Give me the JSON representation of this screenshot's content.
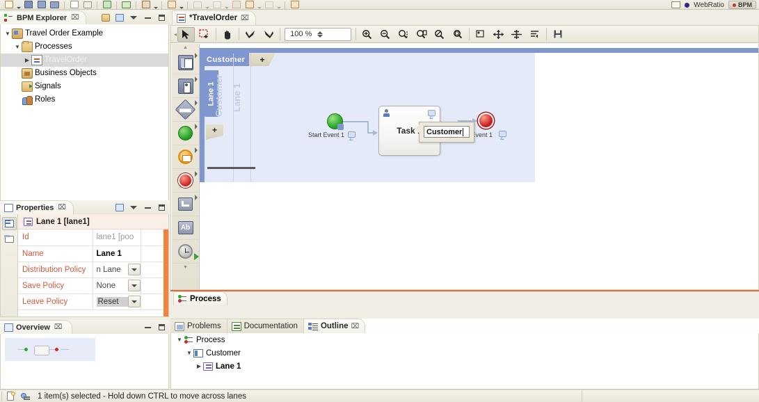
{
  "global_toolbar": {
    "icons": [
      "new-wizard-icon",
      "open-perspective-icon",
      "save-icon",
      "save-all-icon",
      "new-page-icon",
      "new-unit-icon",
      "deploy-icon",
      "link-icon",
      "run-icon",
      "debug-icon",
      "search-icon",
      "history-back-icon",
      "history-forward-icon",
      "undo-icon",
      "redo-icon",
      "quick-access-icon"
    ]
  },
  "perspective_bar": {
    "open_perspective_icon": "open-perspective-icon",
    "product_name": "WebRatio",
    "active_perspective": "BPM"
  },
  "explorer": {
    "tab_label": "BPM Explorer",
    "tab_icon": "bpm-explorer-icon",
    "close_label": "⌧",
    "toolbar": [
      {
        "name": "collapse-all-icon",
        "label": ""
      },
      {
        "name": "link-with-editor-icon",
        "label": ""
      },
      {
        "name": "view-menu-icon",
        "label": ""
      },
      {
        "name": "minimize-icon",
        "label": ""
      },
      {
        "name": "maximize-icon",
        "label": ""
      }
    ],
    "tree": [
      {
        "label": "Travel Order Example",
        "indent": 0,
        "twisty": "open",
        "icon": "project-icon",
        "selected": false
      },
      {
        "label": "Processes",
        "indent": 1,
        "twisty": "open",
        "icon": "folder-icon",
        "selected": false
      },
      {
        "label": "TravelOrder",
        "indent": 2,
        "twisty": "closed",
        "icon": "process-file-icon",
        "selected": true
      },
      {
        "label": "Business Objects",
        "indent": 1,
        "twisty": "none",
        "icon": "business-objects-icon",
        "selected": false
      },
      {
        "label": "Signals",
        "indent": 1,
        "twisty": "none",
        "icon": "signals-icon",
        "selected": false
      },
      {
        "label": "Roles",
        "indent": 1,
        "twisty": "none",
        "icon": "roles-icon",
        "selected": false
      }
    ]
  },
  "properties": {
    "tab_label": "Properties",
    "tab_icon": "properties-icon",
    "close_label": "⌧",
    "toolbar": [
      {
        "name": "pin-properties-icon"
      },
      {
        "name": "view-menu-icon"
      },
      {
        "name": "minimize-icon"
      },
      {
        "name": "maximize-icon"
      }
    ],
    "side_tabs": [
      {
        "name": "general-tab-icon",
        "active": true
      },
      {
        "name": "advanced-tab-icon",
        "active": false
      }
    ],
    "header_title": "Lane 1 [lane1]",
    "header_icon": "lane-icon",
    "rows": [
      {
        "key": "Id",
        "value": "lane1  [poo",
        "type": "text",
        "muted": true,
        "bold": false
      },
      {
        "key": "Name",
        "value": "Lane 1",
        "type": "text",
        "muted": false,
        "bold": true
      },
      {
        "key": "Distribution Policy",
        "value": "n Lane",
        "type": "combo",
        "muted": false,
        "bold": false
      },
      {
        "key": "Save Policy",
        "value": "None",
        "type": "combo",
        "muted": false,
        "bold": false
      },
      {
        "key": "Leave Policy",
        "value": "Reset",
        "type": "combo",
        "muted": false,
        "bold": false,
        "highlight": true
      }
    ],
    "scrollbar_color": "#f2833e"
  },
  "overview": {
    "tab_label": "Overview",
    "tab_icon": "overview-icon",
    "close_label": "⌧",
    "toolbar": [
      {
        "name": "minimize-icon"
      },
      {
        "name": "maximize-icon"
      }
    ]
  },
  "editor": {
    "tab_label": "*TravelOrder",
    "tab_icon": "process-file-icon",
    "close_label": "⌧",
    "dirty": true,
    "toolbar": {
      "tools": [
        {
          "name": "select-tool-button",
          "pressed": true
        },
        {
          "name": "marquee-tool-button",
          "pressed": false
        },
        {
          "name": "pan-tool-button",
          "pressed": false
        },
        {
          "name": "previous-tool-button",
          "pressed": false
        },
        {
          "name": "next-tool-button",
          "pressed": false
        }
      ],
      "zoom_value": "100 %",
      "zoom_buttons": [
        {
          "name": "zoom-in-button"
        },
        {
          "name": "zoom-out-button"
        },
        {
          "name": "zoom-fit-width-button"
        },
        {
          "name": "zoom-fit-page-button"
        },
        {
          "name": "zoom-actual-size-button"
        },
        {
          "name": "zoom-selection-button"
        }
      ],
      "align_buttons": [
        {
          "name": "align-center-button"
        },
        {
          "name": "distribute-horizontal-button"
        },
        {
          "name": "distribute-vertical-button"
        },
        {
          "name": "order-button"
        },
        {
          "name": "save-image-button"
        }
      ]
    },
    "palette": [
      {
        "name": "pool-palette-item",
        "flyout": true
      },
      {
        "name": "lane-palette-item",
        "flyout": true
      },
      {
        "name": "gateway-palette-item",
        "flyout": true
      },
      {
        "name": "start-event-palette-item",
        "flyout": true
      },
      {
        "name": "intermediate-event-palette-item",
        "flyout": true
      },
      {
        "name": "end-event-palette-item",
        "flyout": true
      },
      {
        "name": "sequence-flow-palette-item",
        "flyout": true
      },
      {
        "name": "annotation-palette-item",
        "flyout": false,
        "text": "Ab"
      },
      {
        "name": "timer-palette-item",
        "flyout": false
      }
    ],
    "diagram": {
      "pool_name": "Customer",
      "pool_add_label": "+",
      "lane_name": "Lane 1",
      "lane_add_label": "+",
      "watermark_pool": "Customer",
      "watermark_lane": "Lane 1",
      "nodes": [
        {
          "name": "start-event",
          "label": "Start Event 1",
          "type": "start"
        },
        {
          "name": "task-1",
          "label": "Task 1",
          "type": "user-task"
        },
        {
          "name": "end-event",
          "label": "End Event 1",
          "type": "end"
        }
      ]
    },
    "inline_edit": {
      "name": "pool-name-edit-input",
      "value": "Customer"
    },
    "bottom_tab": {
      "label": "Process",
      "icon": "process-icon"
    }
  },
  "bottom_stack": {
    "tabs": [
      {
        "label": "Problems",
        "icon": "problems-icon",
        "active": false,
        "close": ""
      },
      {
        "label": "Documentation",
        "icon": "documentation-icon",
        "active": false,
        "close": ""
      },
      {
        "label": "Outline",
        "icon": "outline-icon",
        "active": true,
        "close": "⌧"
      }
    ],
    "toolbar": [
      {
        "name": "minimize-icon"
      },
      {
        "name": "maximize-icon"
      }
    ],
    "outline_tree": [
      {
        "label": "Process",
        "indent": 0,
        "twisty": "open",
        "icon": "process-icon"
      },
      {
        "label": "Customer",
        "indent": 1,
        "twisty": "open",
        "icon": "pool-icon"
      },
      {
        "label": "Lane 1",
        "indent": 2,
        "twisty": "closed",
        "icon": "lane-icon"
      }
    ]
  },
  "status_bar": {
    "icons": [
      "selection-mode-icon",
      "lane-status-icon"
    ],
    "message": "1 item(s) selected - Hold down CTRL to move across lanes"
  },
  "colors": {
    "pool_header": "#7f96cf",
    "lane_fill": "#e4eaf7",
    "property_key": "#d4593a",
    "selection": "#d9d9d9",
    "accent_orange": "#e2673a"
  }
}
